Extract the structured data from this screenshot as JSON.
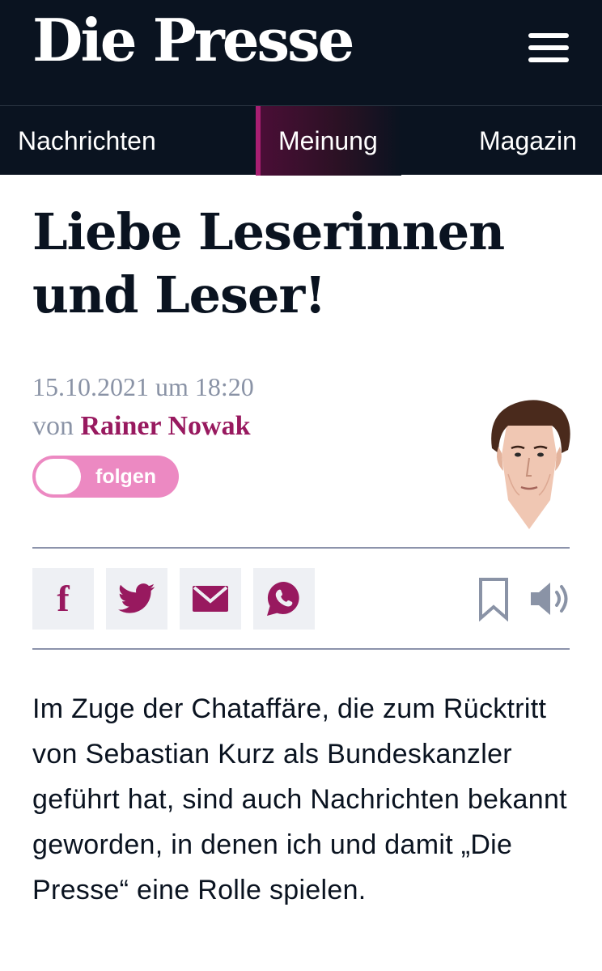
{
  "masthead": {
    "logo_text": "Die Presse",
    "menu_icon": "hamburger-menu-icon"
  },
  "nav": {
    "tabs": [
      {
        "label": "Nachrichten",
        "active": false
      },
      {
        "label": "Meinung",
        "active": true
      },
      {
        "label": "Magazin",
        "active": false
      }
    ]
  },
  "article": {
    "headline": "Liebe Leserinnen und Leser!",
    "date": "15.10.2021 um 18:20",
    "byline_prefix": "von",
    "author": "Rainer Nowak",
    "follow_label": "folgen",
    "portrait_icon": "author-portrait-illustration",
    "body": "Im Zuge der Chataffäre, die zum Rücktritt von Sebastian Kurz als Bundeskanzler geführt hat, sind auch Nachrichten bekannt geworden, in denen ich und damit „Die Presse“ eine Rolle spielen."
  },
  "share": {
    "icons": [
      "facebook-icon",
      "twitter-icon",
      "mail-icon",
      "whatsapp-icon"
    ],
    "bookmark_icon": "bookmark-icon",
    "audio_icon": "speaker-icon"
  },
  "colors": {
    "navy": "#0a1320",
    "accent_magenta": "#98195f",
    "toggle_pink": "#ec89c2",
    "meta_gray": "#8a93a6",
    "share_bg": "#eef0f4"
  }
}
